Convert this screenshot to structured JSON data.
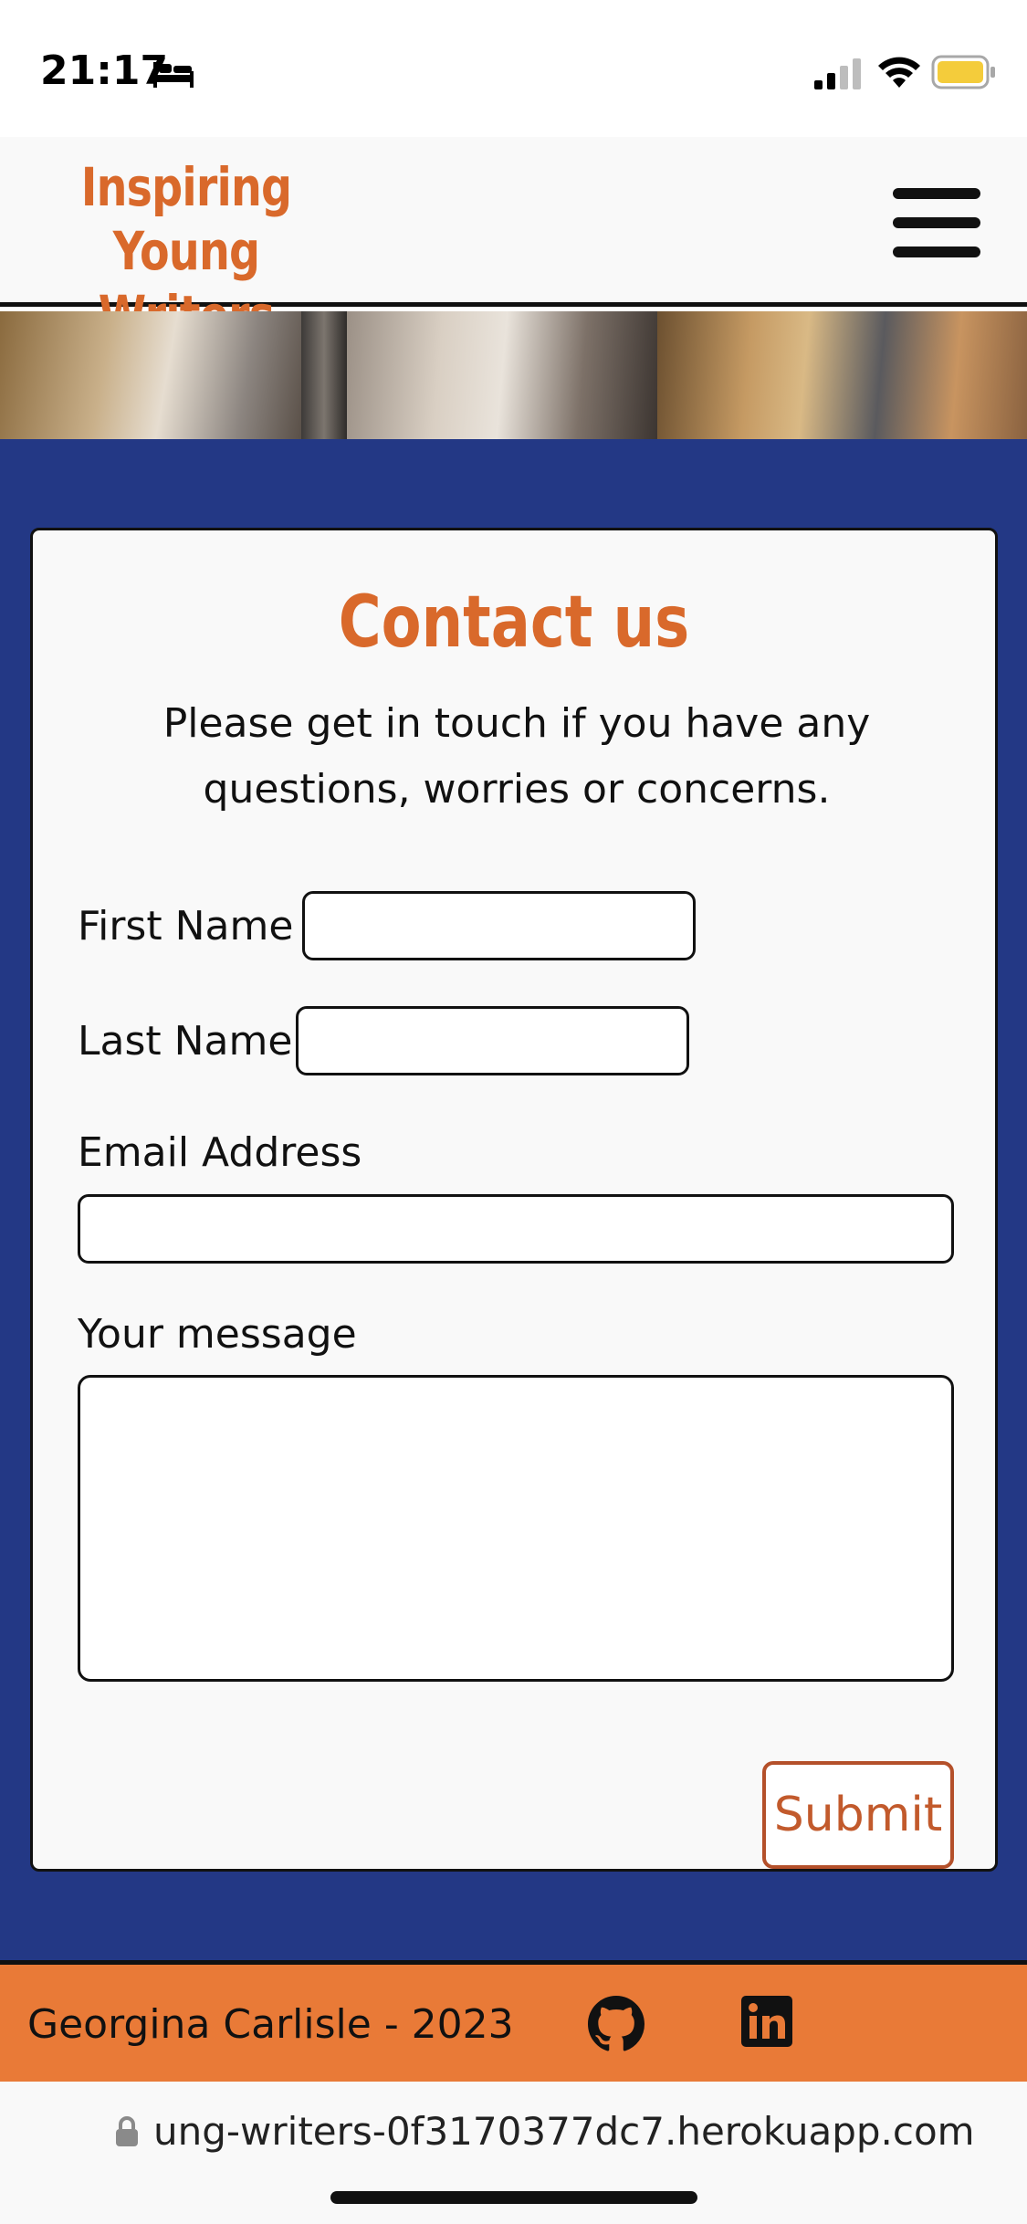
{
  "status_bar": {
    "time": "21:17"
  },
  "header": {
    "logo_line1": "Inspiring Young",
    "logo_line2": "Writers"
  },
  "contact": {
    "title": "Contact us",
    "intro": "Please get in touch if you have any questions, worries or concerns.",
    "first_name_label": "First Name",
    "last_name_label": "Last Name",
    "email_label": "Email Address",
    "message_label": "Your message",
    "submit_label": "Submit"
  },
  "footer": {
    "credit": "Georgina Carlisle - 2023"
  },
  "browser": {
    "url": "ung-writers-0f3170377dc7.herokuapp.com"
  },
  "colors": {
    "brand_orange": "#d9692b",
    "footer_orange": "#e97a37",
    "main_blue": "#233885"
  },
  "icons": [
    "bed-icon",
    "signal-icon",
    "wifi-icon",
    "battery-icon",
    "menu-icon",
    "github-icon",
    "linkedin-icon",
    "lock-icon"
  ]
}
